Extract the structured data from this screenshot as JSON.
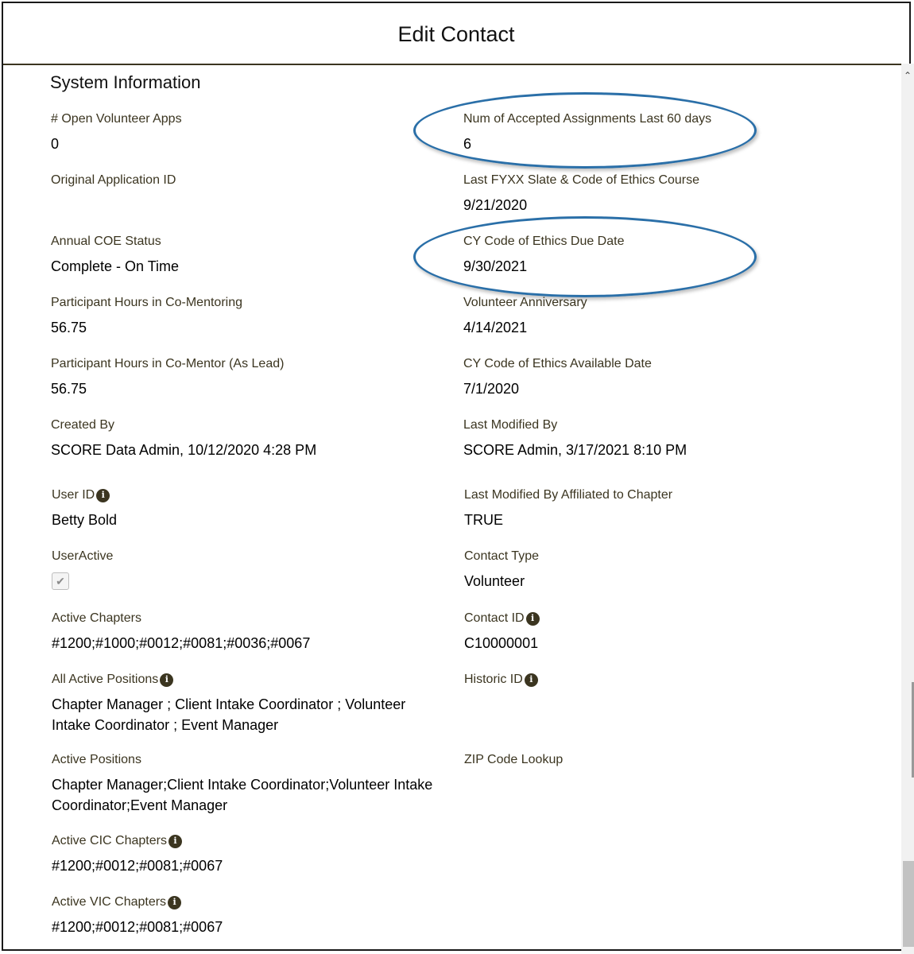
{
  "modal": {
    "title": "Edit Contact"
  },
  "section": {
    "title": "System Information"
  },
  "fields_left": [
    {
      "label": "# Open Volunteer Apps",
      "value": "0"
    },
    {
      "label": "Original Application ID",
      "value": ""
    },
    {
      "label": "Annual COE Status",
      "value": "Complete - On Time"
    },
    {
      "label": "Participant Hours in Co-Mentoring",
      "value": "56.75"
    },
    {
      "label": "Participant Hours in Co-Mentor (As Lead)",
      "value": "56.75"
    },
    {
      "label": "Created By",
      "value": "SCORE Data Admin, 10/12/2020 4:28 PM"
    },
    {
      "label": "User ID",
      "value": "Betty Bold"
    },
    {
      "label": "UserActive",
      "value": ""
    },
    {
      "label": "Active Chapters",
      "value": "#1200;#1000;#0012;#0081;#0036;#0067"
    },
    {
      "label": "All Active Positions",
      "value": "Chapter Manager ; Client Intake Coordinator ; Volunteer Intake Coordinator ; Event Manager"
    },
    {
      "label": "Active Positions",
      "value": "Chapter Manager;Client Intake Coordinator;Volunteer Intake Coordinator;Event Manager"
    },
    {
      "label": "Active CIC Chapters",
      "value": "#1200;#0012;#0081;#0067"
    },
    {
      "label": "Active VIC Chapters",
      "value": "#1200;#0012;#0081;#0067"
    }
  ],
  "fields_right": [
    {
      "label": "Num of Accepted Assignments Last 60 days",
      "value": "6"
    },
    {
      "label": "Last FYXX Slate & Code of Ethics Course",
      "value": "9/21/2020"
    },
    {
      "label": "CY Code of Ethics Due Date",
      "value": "9/30/2021"
    },
    {
      "label": "Volunteer Anniversary",
      "value": "4/14/2021"
    },
    {
      "label": "CY Code of Ethics Available Date",
      "value": "7/1/2020"
    },
    {
      "label": "Last Modified By",
      "value": "SCORE Admin, 3/17/2021 8:10 PM"
    },
    {
      "label": "Last Modified By Affiliated to Chapter",
      "value": "TRUE"
    },
    {
      "label": "Contact Type",
      "value": "Volunteer"
    },
    {
      "label": "Contact ID",
      "value": "C10000001"
    },
    {
      "label": "Historic ID",
      "value": ""
    },
    {
      "label": "ZIP Code Lookup",
      "value": ""
    }
  ],
  "icons": {
    "info": "info-icon",
    "check": "check-icon",
    "scroll_up": "chevron-up-icon"
  },
  "colors": {
    "label": "#3b3520",
    "highlight": "#2a6fa8"
  },
  "useractive_checked": true
}
